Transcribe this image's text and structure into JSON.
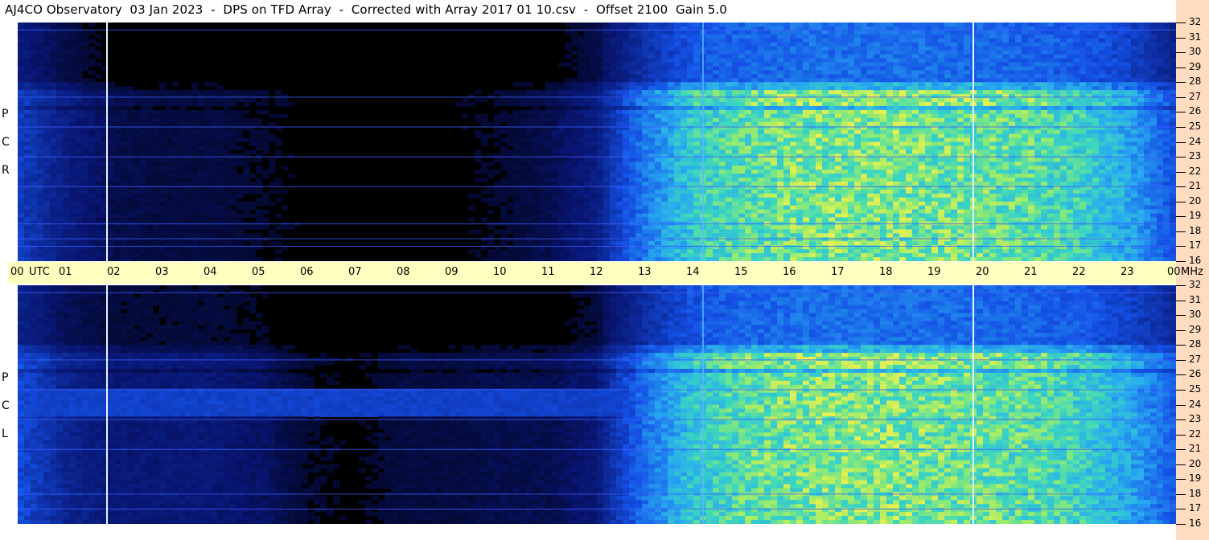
{
  "title": "AJ4CO Observatory  03 Jan 2023  -  DPS on TFD Array  -  Corrected with Array 2017 01 10.csv  -  Offset 2100  Gain 5.0",
  "colors": {
    "background": "#000000",
    "time_band": "#ffffc0",
    "freq_strip": "#fedcc0",
    "low": "#0a1e8c",
    "mid": "#1f6fff",
    "high": "#33d6c8",
    "peak": "#c8f060"
  },
  "chart_data": [
    {
      "type": "heatmap",
      "title": "",
      "panel_label": [
        "R",
        "C",
        "P"
      ],
      "x": {
        "label": "UTC",
        "range": [
          0,
          24
        ],
        "tick_labels": [
          "00",
          "UTC",
          "01",
          "02",
          "03",
          "04",
          "05",
          "06",
          "07",
          "08",
          "09",
          "10",
          "11",
          "12",
          "13",
          "14",
          "15",
          "16",
          "17",
          "18",
          "19",
          "20",
          "21",
          "22",
          "23",
          "00",
          "MHz"
        ]
      },
      "y": {
        "label": "MHz",
        "range": [
          16,
          32
        ],
        "tick_labels": [
          "32",
          "31",
          "30",
          "29",
          "28",
          "27",
          "26",
          "25",
          "24",
          "23",
          "22",
          "21",
          "20",
          "19",
          "18",
          "17",
          "16"
        ]
      },
      "intensity_by_hour": [
        0.25,
        0.12,
        0.06,
        0.05,
        0.05,
        0.04,
        0.03,
        0.03,
        0.03,
        0.03,
        0.04,
        0.06,
        0.12,
        0.45,
        0.75,
        0.85,
        0.9,
        0.92,
        0.92,
        0.9,
        0.88,
        0.85,
        0.78,
        0.6,
        0.3
      ],
      "vertical_lines_utc": [
        1.85,
        14.2,
        19.8
      ],
      "horizontal_lines_mhz": [
        31.5,
        27.0,
        25.0,
        23.0,
        21.0,
        18.5,
        17.5,
        17.0
      ]
    },
    {
      "type": "heatmap",
      "title": "",
      "panel_label": [
        "L",
        "C",
        "P"
      ],
      "x": {
        "label": "UTC",
        "range": [
          0,
          24
        ]
      },
      "y": {
        "label": "MHz",
        "range": [
          16,
          32
        ],
        "tick_labels": [
          "32",
          "31",
          "30",
          "29",
          "28",
          "27",
          "26",
          "25",
          "24",
          "23",
          "22",
          "21",
          "20",
          "19",
          "18",
          "17",
          "16"
        ]
      },
      "intensity_by_hour": [
        0.3,
        0.15,
        0.1,
        0.1,
        0.1,
        0.08,
        0.04,
        0.03,
        0.05,
        0.05,
        0.06,
        0.06,
        0.1,
        0.42,
        0.72,
        0.85,
        0.9,
        0.92,
        0.92,
        0.9,
        0.88,
        0.85,
        0.78,
        0.6,
        0.35
      ],
      "band_mhz": [
        23.2,
        25.0
      ],
      "band_utc": [
        0,
        12.5
      ],
      "vertical_lines_utc": [
        1.85,
        14.2,
        19.8
      ],
      "horizontal_lines_mhz": [
        31.5,
        27.0,
        25.0,
        23.0,
        21.0,
        18.0,
        17.0
      ]
    }
  ]
}
